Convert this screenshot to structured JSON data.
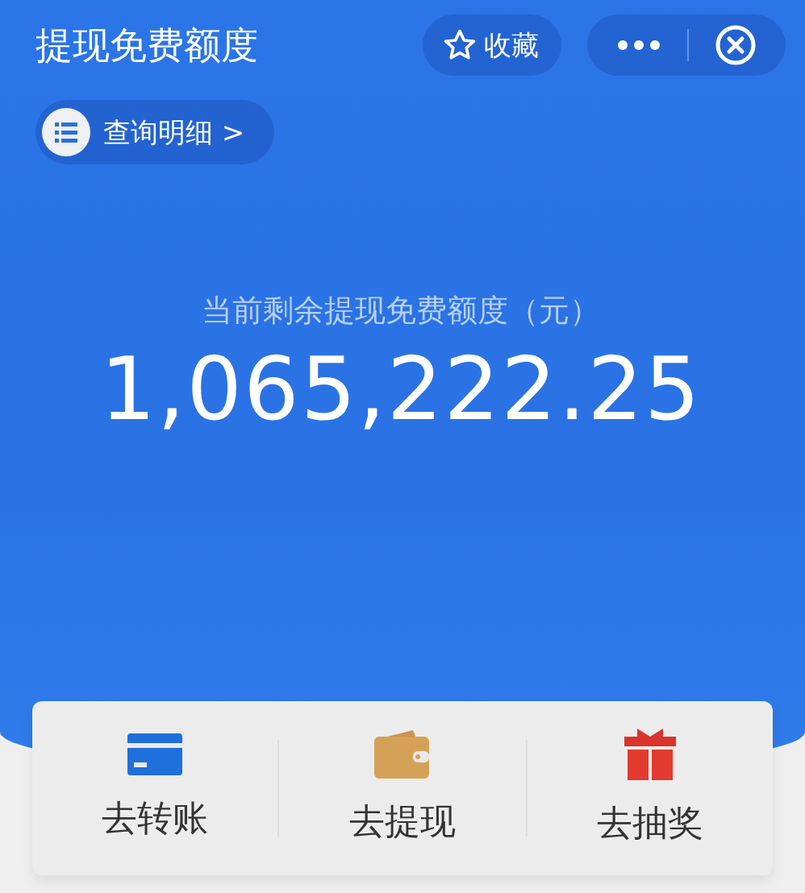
{
  "title": "提现免费额度",
  "favorite_button": {
    "label": "收藏"
  },
  "detail_link": {
    "label": "查询明细 >"
  },
  "balance": {
    "label": "当前剩余提现免费额度（元）",
    "amount": "1,065,222.25"
  },
  "actions": [
    {
      "kind": "card",
      "label": "去转账"
    },
    {
      "kind": "wallet",
      "label": "去提现"
    },
    {
      "kind": "gift",
      "label": "去抽奖"
    }
  ]
}
